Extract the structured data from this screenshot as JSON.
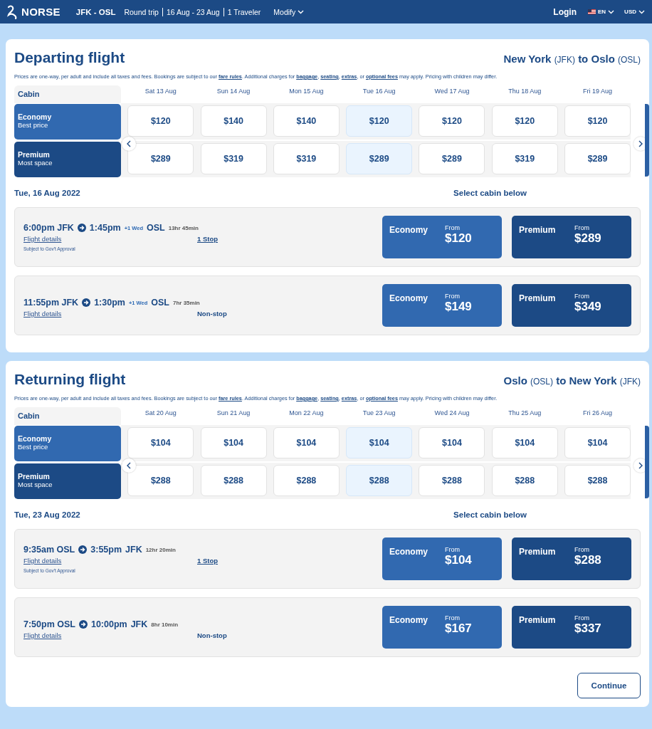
{
  "header": {
    "logo": "NORSE",
    "route": "JFK - OSL",
    "trip_info": [
      "Round trip",
      "16 Aug - 23 Aug",
      "1 Traveler"
    ],
    "modify": "Modify",
    "login": "Login",
    "language": "EN",
    "currency": "USD"
  },
  "sections": [
    {
      "title": "Departing flight",
      "route": {
        "from": "New York",
        "from_code": "(JFK)",
        "joiner": "to",
        "to": "Oslo",
        "to_code": "(OSL)"
      },
      "notice": [
        {
          "text": "Prices are one-way, per adult and include all taxes and fees. Bookings are subject to our ",
          "link": false
        },
        {
          "text": "fare rules",
          "link": true
        },
        {
          "text": ". Additional charges for ",
          "link": false
        },
        {
          "text": "baggage",
          "link": true
        },
        {
          "text": ", ",
          "link": false
        },
        {
          "text": "seating",
          "link": true
        },
        {
          "text": ", ",
          "link": false
        },
        {
          "text": "extras",
          "link": true
        },
        {
          "text": ", or ",
          "link": false
        },
        {
          "text": "optional fees",
          "link": true
        },
        {
          "text": " may apply. Pricing with children may differ.",
          "link": false
        }
      ],
      "cabin_heading": "Cabin",
      "dates": [
        {
          "label": "Sat 13 Aug",
          "selected": false
        },
        {
          "label": "Sun 14 Aug",
          "selected": false
        },
        {
          "label": "Mon 15 Aug",
          "selected": false
        },
        {
          "label": "Tue 16 Aug",
          "selected": true
        },
        {
          "label": "Wed 17 Aug",
          "selected": false
        },
        {
          "label": "Thu 18 Aug",
          "selected": false
        },
        {
          "label": "Fri 19 Aug",
          "selected": false
        }
      ],
      "cabins": [
        {
          "kind": "economy",
          "name": "Economy",
          "subtitle": "Best price",
          "prices": [
            "$120",
            "$140",
            "$140",
            "$120",
            "$120",
            "$120",
            "$120"
          ]
        },
        {
          "kind": "premium",
          "name": "Premium",
          "subtitle": "Most space",
          "prices": [
            "$289",
            "$319",
            "$319",
            "$289",
            "$289",
            "$319",
            "$289"
          ]
        }
      ],
      "day_label": "Tue, 16 Aug 2022",
      "select_hint": "Select cabin below",
      "flights": [
        {
          "dep_time": "6:00pm",
          "dep_code": "JFK",
          "arr_time": "1:45pm",
          "day_note": "+1 Wed",
          "arr_code": "OSL",
          "duration": "13hr 45min",
          "details": "Flight details",
          "stops": "1 Stop",
          "stops_link": true,
          "note": "Subject to Gov't Approval",
          "fares": [
            {
              "kind": "economy",
              "cabin": "Economy",
              "from": "From",
              "price": "$120"
            },
            {
              "kind": "premium",
              "cabin": "Premium",
              "from": "From",
              "price": "$289"
            }
          ]
        },
        {
          "dep_time": "11:55pm",
          "dep_code": "JFK",
          "arr_time": "1:30pm",
          "day_note": "+1 Wed",
          "arr_code": "OSL",
          "duration": "7hr 35min",
          "details": "Flight details",
          "stops": "Non-stop",
          "stops_link": false,
          "fares": [
            {
              "kind": "economy",
              "cabin": "Economy",
              "from": "From",
              "price": "$149"
            },
            {
              "kind": "premium",
              "cabin": "Premium",
              "from": "From",
              "price": "$349"
            }
          ]
        }
      ]
    },
    {
      "title": "Returning flight",
      "route": {
        "from": "Oslo",
        "from_code": "(OSL)",
        "joiner": "to",
        "to": "New York",
        "to_code": "(JFK)"
      },
      "notice": [
        {
          "text": "Prices are one-way, per adult and include all taxes and fees. Bookings are subject to our ",
          "link": false
        },
        {
          "text": "fare rules",
          "link": true
        },
        {
          "text": ". Additional charges for ",
          "link": false
        },
        {
          "text": "baggage",
          "link": true
        },
        {
          "text": ", ",
          "link": false
        },
        {
          "text": "seating",
          "link": true
        },
        {
          "text": ", ",
          "link": false
        },
        {
          "text": "extras",
          "link": true
        },
        {
          "text": ", or ",
          "link": false
        },
        {
          "text": "optional fees",
          "link": true
        },
        {
          "text": " may apply. Pricing with children may differ.",
          "link": false
        }
      ],
      "cabin_heading": "Cabin",
      "dates": [
        {
          "label": "Sat 20 Aug",
          "selected": false
        },
        {
          "label": "Sun 21 Aug",
          "selected": false
        },
        {
          "label": "Mon 22 Aug",
          "selected": false
        },
        {
          "label": "Tue 23 Aug",
          "selected": true
        },
        {
          "label": "Wed 24 Aug",
          "selected": false
        },
        {
          "label": "Thu 25 Aug",
          "selected": false
        },
        {
          "label": "Fri 26 Aug",
          "selected": false
        }
      ],
      "cabins": [
        {
          "kind": "economy",
          "name": "Economy",
          "subtitle": "Best price",
          "prices": [
            "$104",
            "$104",
            "$104",
            "$104",
            "$104",
            "$104",
            "$104"
          ]
        },
        {
          "kind": "premium",
          "name": "Premium",
          "subtitle": "Most space",
          "prices": [
            "$288",
            "$288",
            "$288",
            "$288",
            "$288",
            "$288",
            "$288"
          ]
        }
      ],
      "day_label": "Tue, 23 Aug 2022",
      "select_hint": "Select cabin below",
      "flights": [
        {
          "dep_time": "9:35am",
          "dep_code": "OSL",
          "arr_time": "3:55pm",
          "arr_code": "JFK",
          "duration": "12hr 20min",
          "details": "Flight details",
          "stops": "1 Stop",
          "stops_link": true,
          "note": "Subject to Gov't Approval",
          "fares": [
            {
              "kind": "economy",
              "cabin": "Economy",
              "from": "From",
              "price": "$104"
            },
            {
              "kind": "premium",
              "cabin": "Premium",
              "from": "From",
              "price": "$288"
            }
          ]
        },
        {
          "dep_time": "7:50pm",
          "dep_code": "OSL",
          "arr_time": "10:00pm",
          "arr_code": "JFK",
          "duration": "8hr 10min",
          "details": "Flight details",
          "stops": "Non-stop",
          "stops_link": false,
          "fares": [
            {
              "kind": "economy",
              "cabin": "Economy",
              "from": "From",
              "price": "$167"
            },
            {
              "kind": "premium",
              "cabin": "Premium",
              "from": "From",
              "price": "$337"
            }
          ]
        }
      ]
    }
  ],
  "continue": "Continue"
}
